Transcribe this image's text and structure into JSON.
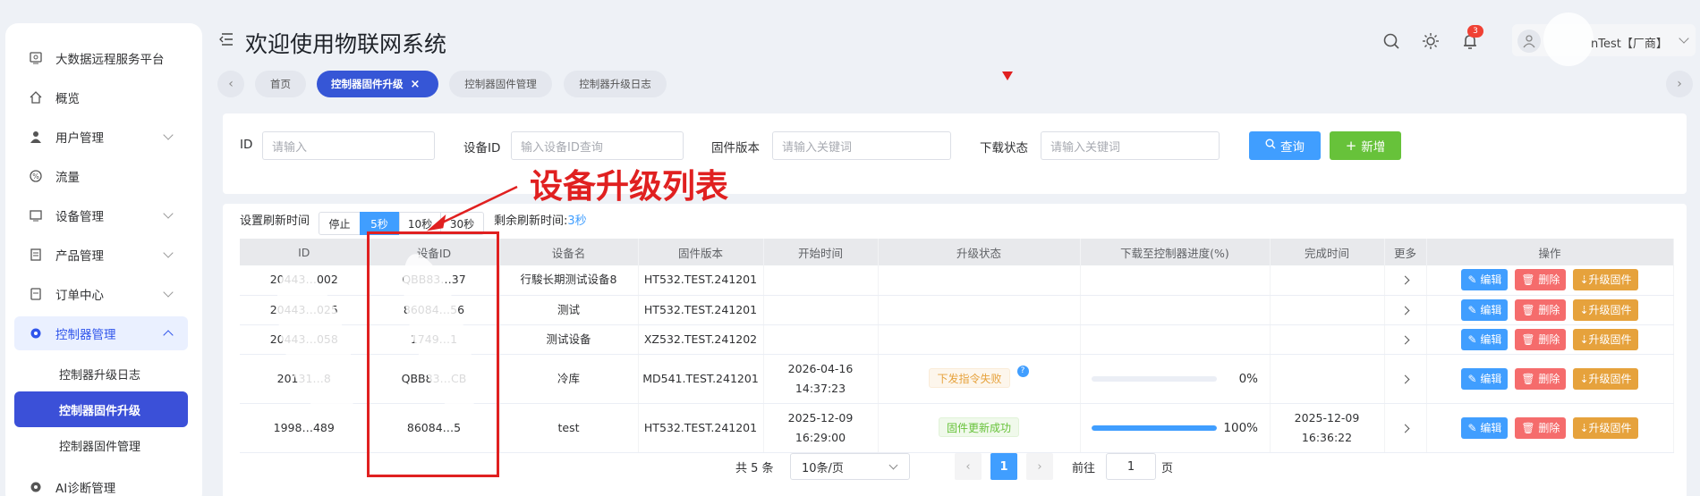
{
  "sidebar": {
    "items": [
      {
        "label": "大数据远程服务平台",
        "icon": "monitor-icon"
      },
      {
        "label": "概览",
        "icon": "home-icon"
      },
      {
        "label": "用户管理",
        "icon": "user-icon"
      },
      {
        "label": "流量",
        "icon": "percent-icon"
      },
      {
        "label": "设备管理",
        "icon": "device-icon"
      },
      {
        "label": "产品管理",
        "icon": "product-icon"
      },
      {
        "label": "订单中心",
        "icon": "order-icon"
      },
      {
        "label": "控制器管理",
        "icon": "gear-icon"
      },
      {
        "label": "AI诊断管理",
        "icon": "gear-icon"
      }
    ],
    "sub_items": [
      "控制器升级日志",
      "控制器固件升级",
      "控制器固件管理"
    ]
  },
  "header": {
    "title": "欢迎使用物联网系统",
    "badge": "3",
    "user": "nTest【厂商】"
  },
  "tabs": [
    "首页",
    "控制器固件升级",
    "控制器固件管理",
    "控制器升级日志"
  ],
  "filters": {
    "id_label": "ID",
    "id_placeholder": "请输入",
    "device_label": "设备ID",
    "device_placeholder": "输入设备ID查询",
    "firmware_label": "固件版本",
    "firmware_placeholder": "请输入关键词",
    "status_label": "下载状态",
    "status_placeholder": "请输入关键词",
    "query": "查询",
    "add": "新增"
  },
  "annotation": "设备升级列表",
  "refresh": {
    "label": "设置刷新时间",
    "options": [
      "停止",
      "5秒",
      "10秒",
      "30秒"
    ],
    "remaining_label": "剩余刷新时间:",
    "remaining_value": "3秒"
  },
  "table": {
    "headers": [
      "ID",
      "设备ID",
      "设备名",
      "固件版本",
      "开始时间",
      "升级状态",
      "下载至控制器进度(%)",
      "完成时间",
      "更多",
      "操作"
    ],
    "rows": [
      {
        "id": "20443…002",
        "device": "QBB83…37",
        "name": "行駿长期测试设备8",
        "fw": "HT532.TEST.241201",
        "start": "",
        "status": "",
        "progress": "",
        "done": ""
      },
      {
        "id": "20443…025",
        "device": "86084…56",
        "name": "测试",
        "fw": "HT532.TEST.241201",
        "start": "",
        "status": "",
        "progress": "",
        "done": ""
      },
      {
        "id": "20443…058",
        "device": "1749…1",
        "name": "测试设备",
        "fw": "XZ532.TEST.241202",
        "start": "",
        "status": "",
        "progress": "",
        "done": ""
      },
      {
        "id": "20131…8",
        "device": "QBB83…CB",
        "name": "冷库",
        "fw": "MD541.TEST.241201",
        "start": "2026-04-16 14:37:23",
        "status": "下发指令失败",
        "progress": "0%",
        "done": ""
      },
      {
        "id": "1998…489",
        "device": "86084…5",
        "name": "test",
        "fw": "HT532.TEST.241201",
        "start": "2025-12-09 16:29:00",
        "status": "固件更新成功",
        "progress": "100%",
        "done": "2025-12-09 16:36:22"
      }
    ],
    "actions": {
      "edit": "编辑",
      "delete": "删除",
      "upgrade": "升级固件"
    },
    "progress_values": [
      null,
      null,
      null,
      0,
      1
    ]
  },
  "pagination": {
    "total": "共 5 条",
    "size": "10条/页",
    "page": "1",
    "goto": "前往",
    "goto_value": "1",
    "page_unit": "页"
  },
  "colors": {
    "accent": "#409eff",
    "success": "#67c23a",
    "danger": "#f56c6c",
    "warning": "#e6a23c",
    "annotation": "#e02020"
  }
}
